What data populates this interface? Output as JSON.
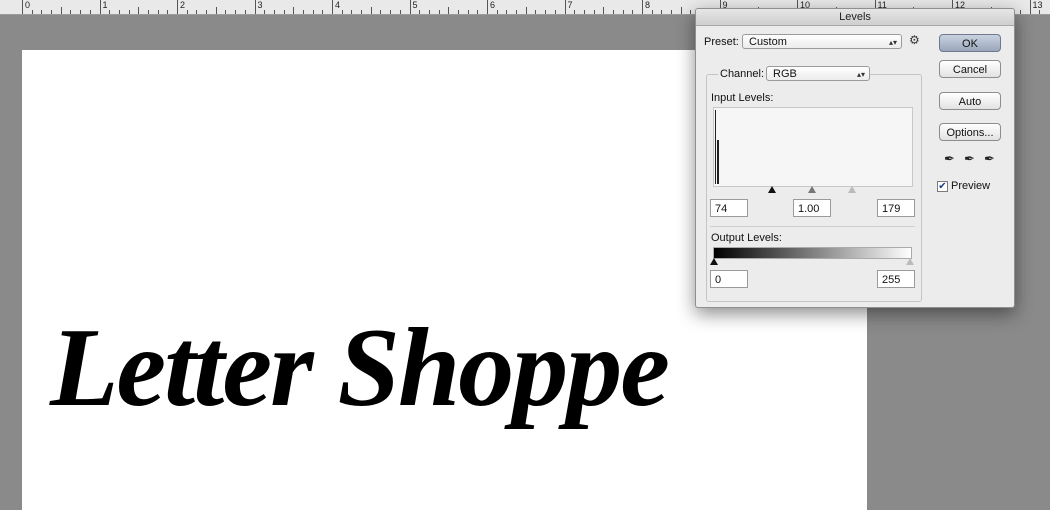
{
  "ruler": {
    "numbers": [
      "0",
      "1",
      "2",
      "3",
      "4",
      "5",
      "6",
      "7",
      "8",
      "9",
      "10",
      "11",
      "12",
      "13"
    ]
  },
  "artwork": {
    "text": "Letter Shoppe"
  },
  "dialog": {
    "title": "Levels",
    "preset_label": "Preset:",
    "preset_value": "Custom",
    "gear_icon": "⚙",
    "buttons": {
      "ok": "OK",
      "cancel": "Cancel",
      "auto": "Auto",
      "options": "Options..."
    },
    "channel_label": "Channel:",
    "channel_value": "RGB",
    "input_levels_label": "Input Levels:",
    "input_values": {
      "shadow": "74",
      "midtone": "1.00",
      "highlight": "179"
    },
    "output_levels_label": "Output Levels:",
    "output_values": {
      "shadow": "0",
      "highlight": "255"
    },
    "preview_label": "Preview",
    "preview_checked": true,
    "icons": [
      "black-eyedropper-icon",
      "gray-eyedropper-icon",
      "white-eyedropper-icon"
    ]
  }
}
